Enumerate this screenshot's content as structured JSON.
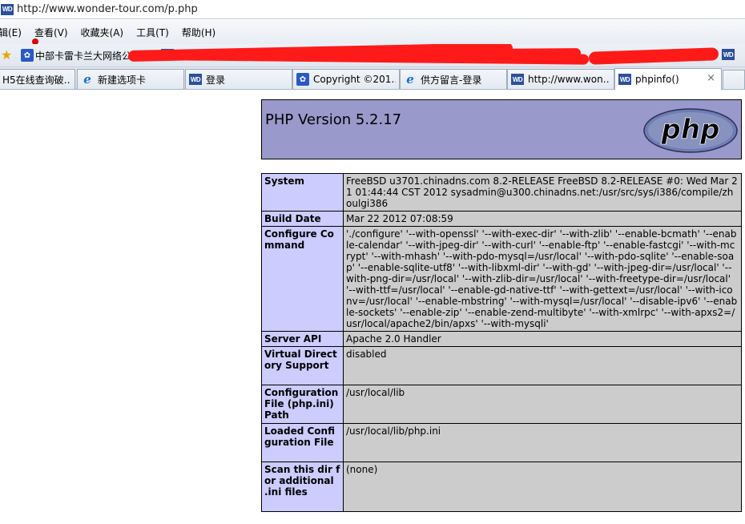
{
  "browser": {
    "url": "http://www.wonder-tour.com/p.php",
    "menu": [
      "辑(E)",
      "查看(V)",
      "收藏夹(A)",
      "工具(T)",
      "帮助(H)"
    ],
    "favorites": {
      "item1_fragment": "中部卡雷卡兰大网络公司"
    },
    "tabs": [
      {
        "label": "H5在线查询破…",
        "icon": "none"
      },
      {
        "label": "新建选项卡",
        "icon": "ie"
      },
      {
        "label": "登录",
        "icon": "wd"
      },
      {
        "label": "Copyright ©201…",
        "icon": "paw"
      },
      {
        "label": "供方留言-登录",
        "icon": "ie"
      },
      {
        "label": "http://www.won…",
        "icon": "wd"
      },
      {
        "label": "phpinfo()",
        "icon": "wd",
        "active": true
      }
    ],
    "close_glyph": "×",
    "wd_glyph": "WD"
  },
  "php": {
    "title": "PHP Version 5.2.17",
    "logo_text": "php",
    "rows": [
      {
        "k": "System",
        "v": "FreeBSD u3701.chinadns.com 8.2-RELEASE FreeBSD 8.2-RELEASE #0: Wed Mar 21 01:44:44 CST 2012 sysadmin@u300.chinadns.net:/usr/src/sys/i386/compile/zhoulgi386"
      },
      {
        "k": "Build Date",
        "v": "Mar 22 2012 07:08:59"
      },
      {
        "k": "Configure Command",
        "v": "'./configure' '--with-openssl' '--with-exec-dir' '--with-zlib' '--enable-bcmath' '--enable-calendar' '--with-jpeg-dir' '--with-curl' '--enable-ftp' '--enable-fastcgi' '--with-mcrypt' '--with-mhash' '--with-pdo-mysql=/usr/local' '--with-pdo-sqlite' '--enable-soap' '--enable-sqlite-utf8' '--with-libxml-dir' '--with-gd' '--with-jpeg-dir=/usr/local' '--with-png-dir=/usr/local' '--with-zlib-dir=/usr/local' '--with-freetype-dir=/usr/local' '--with-ttf=/usr/local' '--enable-gd-native-ttf' '--with-gettext=/usr/local' '--with-iconv=/usr/local' '--enable-mbstring' '--with-mysql=/usr/local' '--disable-ipv6' '--enable-sockets' '--enable-zip' '--enable-zend-multibyte' '--with-xmlrpc' '--with-apxs2=/usr/local/apache2/bin/apxs' '--with-mysqli'"
      },
      {
        "k": "Server API",
        "v": "Apache 2.0 Handler"
      },
      {
        "k": "Virtual Directory Support",
        "v": "disabled"
      },
      {
        "k": "Configuration File (php.ini) Path",
        "v": "/usr/local/lib"
      },
      {
        "k": "Loaded Configuration File",
        "v": "/usr/local/lib/php.ini"
      },
      {
        "k": "Scan this dir for additional .ini files",
        "v": "(none)"
      }
    ]
  },
  "colors": {
    "header": "#9999cc",
    "key": "#ccccff",
    "value": "#cccccc",
    "redaction": "#ff1a1a"
  }
}
